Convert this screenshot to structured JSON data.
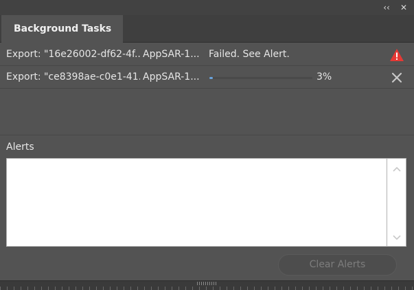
{
  "window": {
    "collapse_glyph": "‹‹",
    "close_glyph": "✕"
  },
  "tabs": [
    {
      "label": "Background Tasks"
    }
  ],
  "tasks": [
    {
      "name": "Export: \"16e26002-df62-4f...",
      "app": "AppSAR-1...",
      "status": "Failed. See Alert.",
      "icon": "warning-icon"
    },
    {
      "name": "Export: \"ce8398ae-c0e1-41...",
      "app": "AppSAR-1...",
      "progress": 3,
      "progress_label": "3%",
      "icon": "close-icon"
    }
  ],
  "alerts": {
    "label": "Alerts",
    "content": ""
  },
  "clear_button": {
    "label": "Clear Alerts"
  },
  "colors": {
    "panel_bg": "#535353",
    "warning_red": "#e53935",
    "progress_blue": "#6aa3dc"
  }
}
